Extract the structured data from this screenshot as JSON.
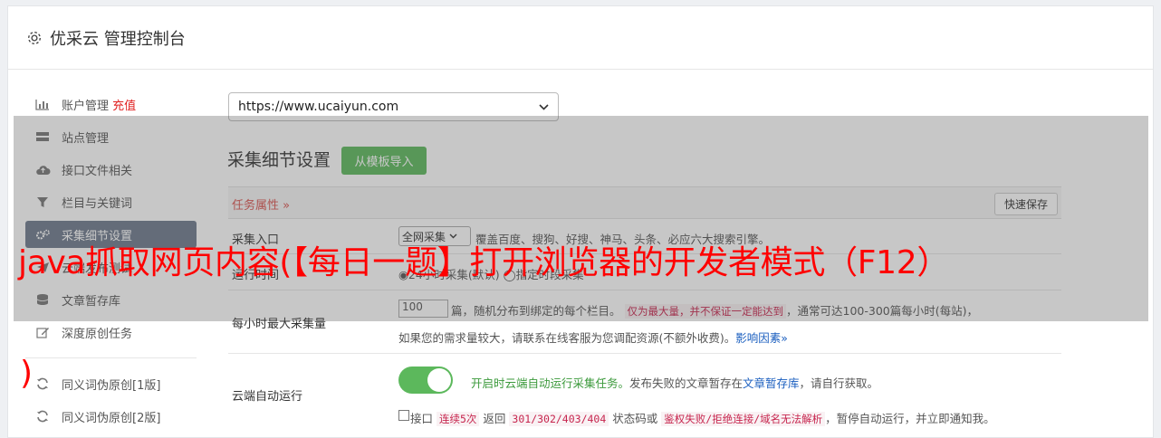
{
  "header": {
    "title": "优采云 管理控制台"
  },
  "sidebar": {
    "items": [
      {
        "label": "账户管理",
        "extra": "充值"
      },
      {
        "label": "站点管理"
      },
      {
        "label": "接口文件相关"
      },
      {
        "label": "栏目与关键词"
      },
      {
        "label": "采集细节设置"
      },
      {
        "label": "云端发布测试"
      },
      {
        "label": "文章暂存库"
      },
      {
        "label": "深度原创任务"
      },
      {
        "label": "同义词伪原创[1版]"
      },
      {
        "label": "同义词伪原创[2版]"
      }
    ]
  },
  "main": {
    "site_select": "https://www.ucaiyun.com",
    "section_title": "采集细节设置",
    "import_button": "从模板导入",
    "task_attr": "任务属性",
    "save_button": "快速保存",
    "rows": {
      "entry": {
        "label": "采集入口",
        "select": "全网采集",
        "desc": "覆盖百度、搜狗、好搜、神马、头条、必应六大搜索引擎。"
      },
      "time": {
        "label": "运行时间",
        "desc_a": "24小时采集(默认)",
        "desc_b": "指定时段采集"
      },
      "max": {
        "label": "每小时最大采集量",
        "value": "100",
        "desc_a": "篇，随机分布到绑定的每个栏目。",
        "code": "仅为最大量，并不保证一定能达到",
        "desc_b": "，通常可达100-300篇每小时(每站)，",
        "desc_c": "如果您的需求量较大，请联系在线客服为您调配资源(不额外收费)。",
        "link": "影响因素"
      },
      "auto": {
        "label": "云端自动运行",
        "on_text": "开启时云端自动运行采集任务。",
        "desc_a": "发布失败的文章暂存在",
        "link": "文章暂存库",
        "desc_b": "，请自行获取。",
        "chk_label": "接口",
        "code1": "连续5次",
        "t1": "返回",
        "code2": "301/302/403/404",
        "t2": "状态码或",
        "code3": "鉴权失败/拒绝连接/域名无法解析",
        "t3": "，暂停自动运行，并立即通知我。"
      }
    }
  },
  "overlay_title": {
    "line1": "java抓取网页内容(【每日一题】打开浏览器的开发者模式（F12）",
    "line2": ")"
  },
  "colors": {
    "accent_green": "#5cb85c",
    "active_nav": "#6d7a8c",
    "red": "#ff0000"
  }
}
